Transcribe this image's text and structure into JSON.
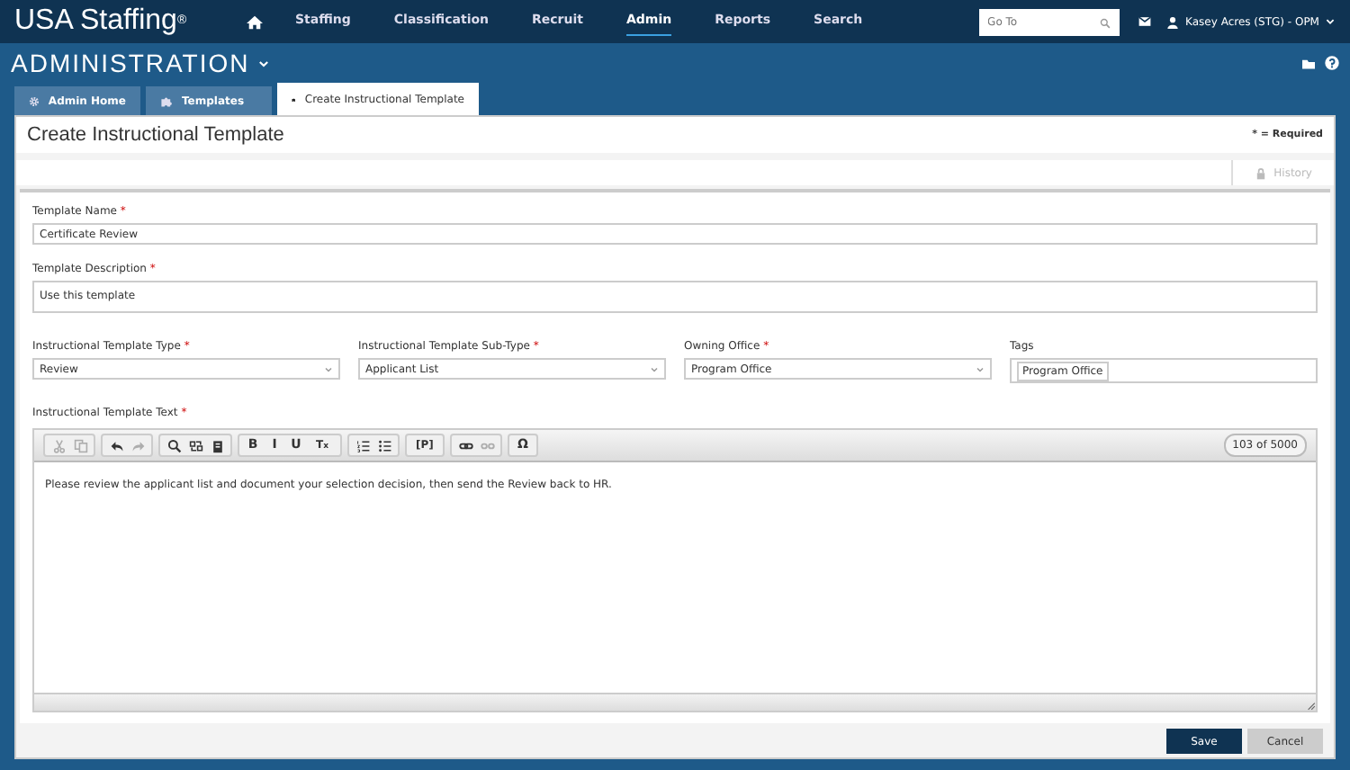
{
  "topnav": {
    "brand": "USA Staffing",
    "brand_mark": "®",
    "items": [
      {
        "label": "Staffing",
        "selected": false
      },
      {
        "label": "Classification",
        "selected": false
      },
      {
        "label": "Recruit",
        "selected": false
      },
      {
        "label": "Admin",
        "selected": true
      },
      {
        "label": "Reports",
        "selected": false
      },
      {
        "label": "Search",
        "selected": false
      }
    ],
    "search": {
      "placeholder": "Go To"
    },
    "user": "Kasey Acres (STG) - OPM"
  },
  "section": {
    "title": "ADMINISTRATION"
  },
  "tabs": [
    {
      "label": "Admin Home",
      "kind": "gear",
      "selected": false
    },
    {
      "label": "Templates",
      "kind": "puzzle",
      "selected": false
    },
    {
      "label": "Create Instructional Template",
      "kind": "puzzle",
      "selected": true
    }
  ],
  "page": {
    "title": "Create Instructional Template",
    "required_note": "* = Required",
    "history": "History"
  },
  "fields": [
    {
      "label": "Template Name",
      "mark": "*",
      "kind": "text",
      "value": "Certificate Review"
    },
    {
      "label": "Template Description",
      "mark": "*",
      "kind": "textarea",
      "value": "Use this template"
    }
  ],
  "selects": [
    {
      "label": "Instructional Template Type",
      "mark": "*",
      "kind": "select",
      "value": "Review"
    },
    {
      "label": "Instructional Template Sub-Type",
      "mark": "*",
      "kind": "select",
      "value": "Applicant List"
    },
    {
      "label": "Owning Office",
      "mark": "*",
      "kind": "select",
      "value": "Program Office"
    },
    {
      "label": "Tags",
      "kind": "tags",
      "value": "Program Office"
    }
  ],
  "editor": {
    "label": "Instructional Template Text",
    "mark": "*",
    "counter": "103 of 5000",
    "body": "Please review the applicant list and document your selection decision, then send the Review back to HR.",
    "toolbar": [
      [
        {
          "kind": "scissors",
          "disabled": true
        },
        {
          "kind": "copy",
          "disabled": true
        }
      ],
      [
        {
          "kind": "undo",
          "disabled": false
        },
        {
          "kind": "redo",
          "disabled": true
        }
      ],
      [
        {
          "kind": "search",
          "disabled": false
        },
        {
          "kind": "replace",
          "disabled": false
        },
        {
          "kind": "paste",
          "disabled": false
        }
      ],
      [
        {
          "kind": "glyph",
          "text": "B",
          "disabled": false
        },
        {
          "kind": "glyph",
          "text": "I",
          "disabled": false
        },
        {
          "kind": "glyph",
          "text": "U",
          "disabled": false
        },
        {
          "kind": "glyph",
          "text": "T$_{x}$",
          "disabled": false
        }
      ],
      [
        {
          "kind": "numlist",
          "disabled": false
        },
        {
          "kind": "bulletlist",
          "disabled": false
        }
      ],
      [
        {
          "kind": "glyph",
          "text": "[P]",
          "disabled": false
        }
      ],
      [
        {
          "kind": "link",
          "disabled": false
        },
        {
          "kind": "unlink",
          "disabled": true
        }
      ],
      [
        {
          "kind": "glyph",
          "text": "Ω",
          "disabled": false
        }
      ]
    ]
  },
  "buttons": [
    {
      "label": "Save",
      "kind": "primary"
    },
    {
      "label": "Cancel",
      "kind": "secondary"
    }
  ]
}
